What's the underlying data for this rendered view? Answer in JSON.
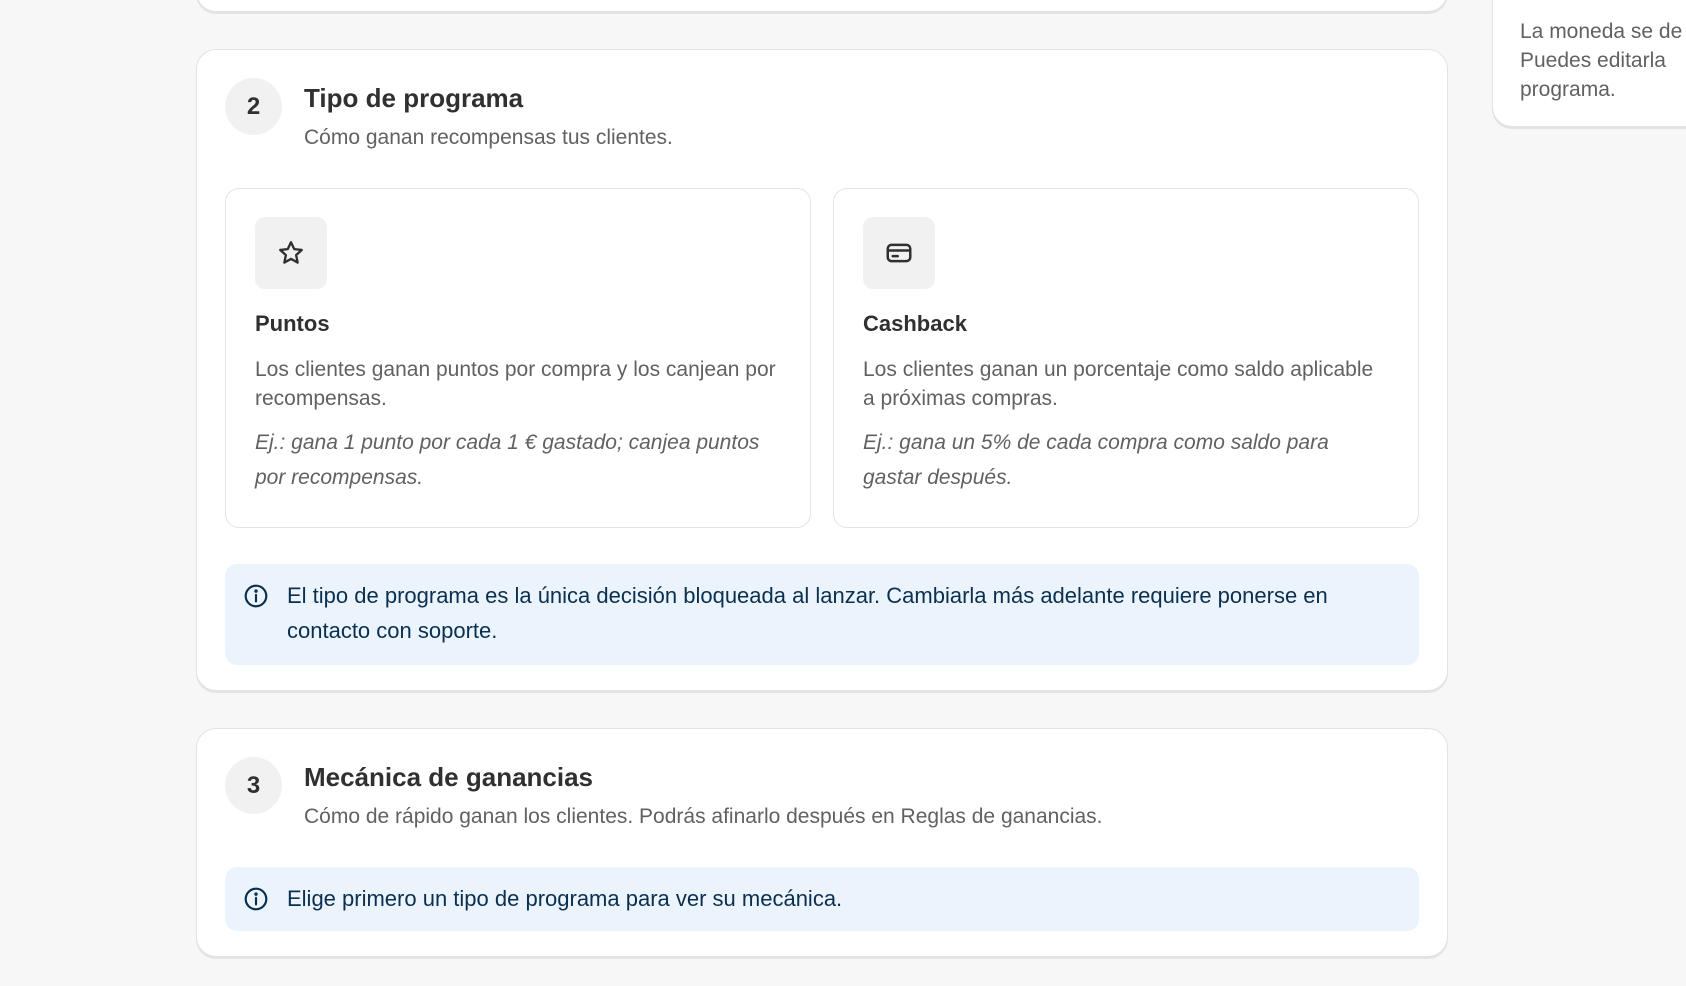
{
  "side_note": {
    "lines": [
      "La moneda se de",
      "Puedes editarla",
      "programa."
    ]
  },
  "section2": {
    "step": "2",
    "title": "Tipo de programa",
    "subtitle": "Cómo ganan recompensas tus clientes.",
    "options": [
      {
        "icon": "star-icon",
        "title": "Puntos",
        "description": "Los clientes ganan puntos por compra y los canjean por recompensas.",
        "example": "Ej.: gana 1 punto por cada 1 € gastado; canjea puntos por recompensas."
      },
      {
        "icon": "credit-card-icon",
        "title": "Cashback",
        "description": "Los clientes ganan un porcentaje como saldo aplicable a próximas compras.",
        "example": "Ej.: gana un 5% de cada compra como saldo para gastar después."
      }
    ],
    "banner": "El tipo de programa es la única decisión bloqueada al lanzar. Cambiarla más adelante requiere ponerse en contacto con soporte."
  },
  "section3": {
    "step": "3",
    "title": "Mecánica de ganancias",
    "subtitle": "Cómo de rápido ganan los clientes. Podrás afinarlo después en Reglas de ganancias.",
    "banner": "Elige primero un tipo de programa para ver su mecánica."
  },
  "colors": {
    "banner_bg": "#ebf4fd",
    "banner_text": "#0b2f4e",
    "page_bg": "#f7f7f7"
  }
}
